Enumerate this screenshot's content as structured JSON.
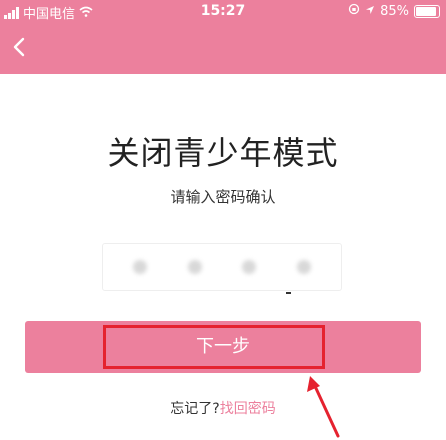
{
  "status_bar": {
    "carrier": "中国电信",
    "time": "15:27",
    "battery": "85%"
  },
  "nav": {
    "back_icon": "chevron-left-icon"
  },
  "page": {
    "title": "关闭青少年模式",
    "subtitle": "请输入密码确认"
  },
  "password": {
    "digits_entered": 4
  },
  "next_button": {
    "label": "下一步"
  },
  "forgot": {
    "question": "忘记了?",
    "link": "找回密码"
  },
  "colors": {
    "accent": "#ec809d",
    "highlight": "#e5222f"
  }
}
